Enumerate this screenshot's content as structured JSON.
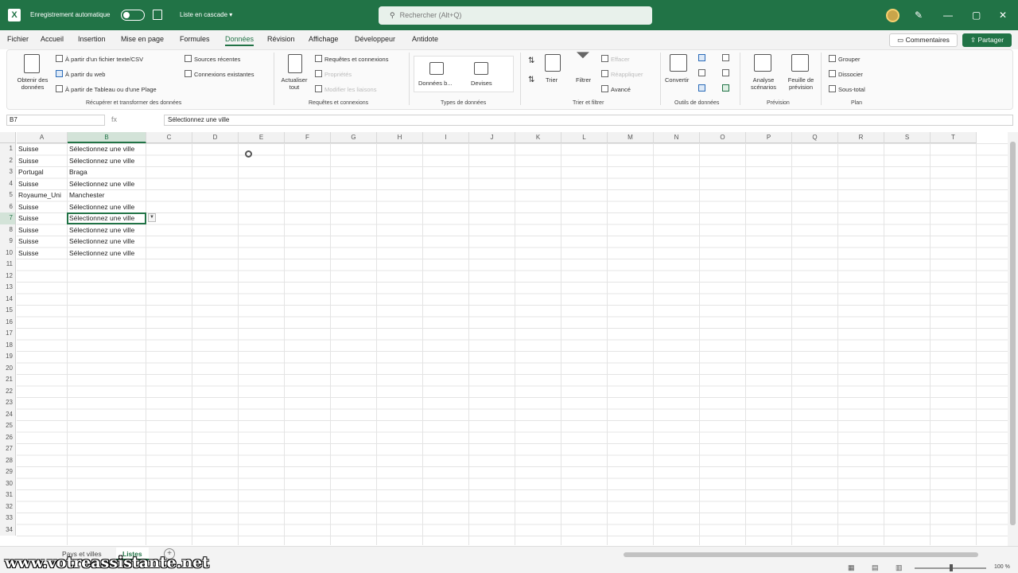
{
  "titlebar": {
    "autosave_label": "Enregistrement automatique",
    "file_name": "Liste en cascade",
    "file_dropdown": "▾",
    "search_placeholder": "Rechercher (Alt+Q)",
    "minimize": "—",
    "maximize": "▢",
    "close": "✕",
    "pen_icon": "✎"
  },
  "menu": {
    "items": [
      "Fichier",
      "Accueil",
      "Insertion",
      "Mise en page",
      "Formules",
      "Données",
      "Révision",
      "Affichage",
      "Développeur",
      "Antidote"
    ],
    "active": "Données",
    "comments_label": "Commentaires",
    "share_label": "Partager"
  },
  "ribbon": {
    "get_data": "Obtenir des données",
    "from_text": "À partir d'un fichier texte/CSV",
    "from_web": "À partir du web",
    "from_table": "À partir de Tableau ou d'une Plage",
    "recent_sources": "Sources récentes",
    "existing_connections": "Connexions existantes",
    "group1_label": "Récupérer et transformer des données",
    "refresh_all": "Actualiser tout",
    "queries_connections": "Requêtes et connexions",
    "properties": "Propriétés",
    "edit_links": "Modifier les liaisons",
    "group2_label": "Requêtes et connexions",
    "data_types_1": "Données b...",
    "data_types_2": "Devises",
    "group3_label": "Types de données",
    "sort": "Trier",
    "filter": "Filtrer",
    "clear": "Effacer",
    "reapply": "Réappliquer",
    "advanced": "Avancé",
    "group4_label": "Trier et filtrer",
    "convert": "Convertir",
    "group5_label": "Outils de données",
    "what_if": "Analyse scénarios",
    "forecast_sheet": "Feuille de prévision",
    "group6_label": "Prévision",
    "group_btn": "Grouper",
    "ungroup_btn": "Dissocier",
    "subtotal": "Sous-total",
    "group7_label": "Plan"
  },
  "formula_bar": {
    "name_box": "B7",
    "fx": "fx",
    "value": "Sélectionnez une ville"
  },
  "sheet": {
    "columns": [
      "A",
      "B",
      "C",
      "D",
      "E",
      "F",
      "G",
      "H",
      "I",
      "J",
      "K",
      "L",
      "M",
      "N",
      "O",
      "P",
      "Q",
      "R",
      "S",
      "T"
    ],
    "row_count": 34,
    "selected_row": 7,
    "selected_col": "B",
    "rows": [
      {
        "a": "Suisse",
        "b": "Sélectionnez une ville"
      },
      {
        "a": "Suisse",
        "b": "Sélectionnez une ville"
      },
      {
        "a": "Portugal",
        "b": "Braga"
      },
      {
        "a": "Suisse",
        "b": "Sélectionnez une ville"
      },
      {
        "a": "Royaume_Uni",
        "b": "Manchester"
      },
      {
        "a": "Suisse",
        "b": "Sélectionnez une ville"
      },
      {
        "a": "Suisse",
        "b": "Sélectionnez une ville"
      },
      {
        "a": "Suisse",
        "b": "Sélectionnez une ville"
      },
      {
        "a": "Suisse",
        "b": "Sélectionnez une ville"
      },
      {
        "a": "Suisse",
        "b": "Sélectionnez une ville"
      }
    ]
  },
  "tabs": [
    {
      "label": "Pays et villes",
      "active": false
    },
    {
      "label": "Listes",
      "active": true
    }
  ],
  "add_sheet": "+",
  "watermark": "www.votreassistante.net",
  "status": {
    "zoom": "100 %"
  },
  "colors": {
    "brand": "#217346",
    "selection": "#d3e3d8"
  }
}
